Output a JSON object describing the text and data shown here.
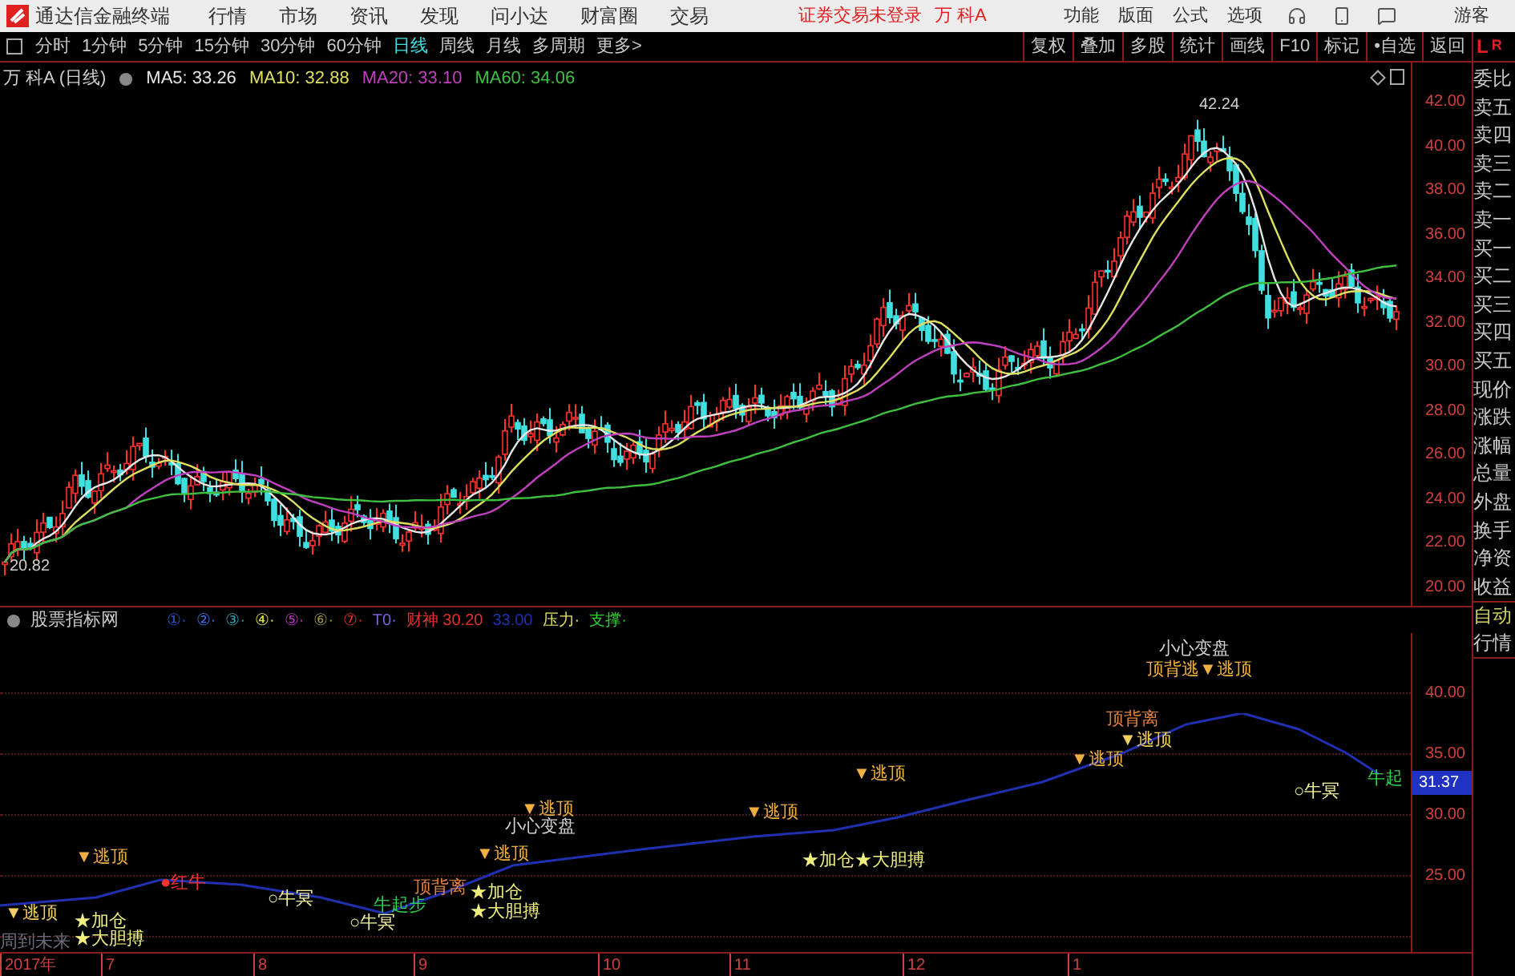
{
  "app_title": "通达信金融终端",
  "menu": [
    "行情",
    "市场",
    "资讯",
    "发现",
    "问小达",
    "财富圈",
    "交易"
  ],
  "login_status": "证券交易未登录",
  "stock_name": "万 科A",
  "top_actions": [
    "功能",
    "版面",
    "公式",
    "选项"
  ],
  "user": "游客",
  "periods": [
    {
      "label": "分时",
      "selected": false
    },
    {
      "label": "1分钟",
      "selected": false
    },
    {
      "label": "5分钟",
      "selected": false
    },
    {
      "label": "15分钟",
      "selected": false
    },
    {
      "label": "30分钟",
      "selected": false
    },
    {
      "label": "60分钟",
      "selected": false
    },
    {
      "label": "日线",
      "selected": true
    },
    {
      "label": "周线",
      "selected": false
    },
    {
      "label": "月线",
      "selected": false
    },
    {
      "label": "多周期",
      "selected": false
    },
    {
      "label": "更多>",
      "selected": false
    }
  ],
  "tools": [
    "复权",
    "叠加",
    "多股",
    "统计",
    "画线",
    "F10",
    "标记",
    "•自选",
    "返回"
  ],
  "price_panel": {
    "title": "万 科A (日线)",
    "ma": [
      {
        "text": "MA5: 33.26",
        "color": "#e8e8e8"
      },
      {
        "text": "MA10: 32.88",
        "color": "#e0e060"
      },
      {
        "text": "MA20: 33.10",
        "color": "#c040c0"
      },
      {
        "text": "MA60: 34.06",
        "color": "#40c040"
      }
    ],
    "high_label": "42.24",
    "low_label": "20.82",
    "axis": [
      "42.00",
      "40.00",
      "38.00",
      "36.00",
      "34.00",
      "32.00",
      "30.00",
      "28.00",
      "26.00",
      "24.00",
      "22.00",
      "20.00"
    ]
  },
  "indicator_panel": {
    "title": "股票指标网",
    "legend": [
      {
        "text": "①·",
        "color": "#3050d0"
      },
      {
        "text": "②·",
        "color": "#4070e0"
      },
      {
        "text": "③·",
        "color": "#30a0b0"
      },
      {
        "text": "④·",
        "color": "#e0e040"
      },
      {
        "text": "⑤·",
        "color": "#c030c0"
      },
      {
        "text": "⑥·",
        "color": "#909040"
      },
      {
        "text": "⑦·",
        "color": "#e03030"
      },
      {
        "text": "T0·",
        "color": "#8060e0"
      },
      {
        "text": "财神 30.20",
        "color": "#e03030"
      },
      {
        "text": "33.00",
        "color": "#2030b0"
      },
      {
        "text": "压力·",
        "color": "#e0e060"
      },
      {
        "text": "支撑·",
        "color": "#30d030"
      }
    ],
    "signals": [
      {
        "text": "▼逃顶",
        "kind": "top"
      },
      {
        "text": "▼逃顶",
        "kind": "warn"
      },
      {
        "text": "★加仓",
        "kind": "add"
      },
      {
        "text": "★大胆搏",
        "kind": "add"
      },
      {
        "text": "周到未来",
        "kind": "faint"
      },
      {
        "text": "●红牛",
        "kind": "red"
      },
      {
        "text": "○牛冥",
        "kind": "bull"
      },
      {
        "text": "顶背离",
        "kind": "divergence"
      },
      {
        "text": "牛起步",
        "kind": "start"
      },
      {
        "text": "○牛冥",
        "kind": "bull"
      },
      {
        "text": "▼逃顶",
        "kind": "top"
      },
      {
        "text": "小心变盘",
        "kind": "caution"
      },
      {
        "text": "▼逃顶",
        "kind": "top"
      },
      {
        "text": "★加仓",
        "kind": "add"
      },
      {
        "text": "★大胆搏",
        "kind": "add"
      },
      {
        "text": "▼逃顶",
        "kind": "top"
      },
      {
        "text": "★加仓★大胆搏",
        "kind": "add"
      },
      {
        "text": "▼逃顶",
        "kind": "top"
      },
      {
        "text": "小心变盘",
        "kind": "caution"
      },
      {
        "text": "顶背逃▼逃顶",
        "kind": "top"
      },
      {
        "text": "顶背离",
        "kind": "divergence"
      },
      {
        "text": "▼逃顶",
        "kind": "warn"
      },
      {
        "text": "▼逃顶",
        "kind": "top"
      },
      {
        "text": "○牛冥",
        "kind": "bull"
      },
      {
        "text": "牛起",
        "kind": "start"
      }
    ],
    "axis": [
      "40.00",
      "35.00",
      "30.00",
      "25.00"
    ],
    "current": "31.37"
  },
  "time_axis": [
    "2017年",
    "7",
    "8",
    "9",
    "10",
    "11",
    "12",
    "1"
  ],
  "side_header": [
    "L",
    "R"
  ],
  "quote_fields": [
    "委比",
    "卖五",
    "卖四",
    "卖三",
    "卖二",
    "卖一",
    "买一",
    "买二",
    "买三",
    "买四",
    "买五",
    "现价",
    "涨跌",
    "涨幅",
    "总量",
    "外盘",
    "换手",
    "净资",
    "收益"
  ],
  "side_footer": [
    "自动",
    "行情"
  ]
}
